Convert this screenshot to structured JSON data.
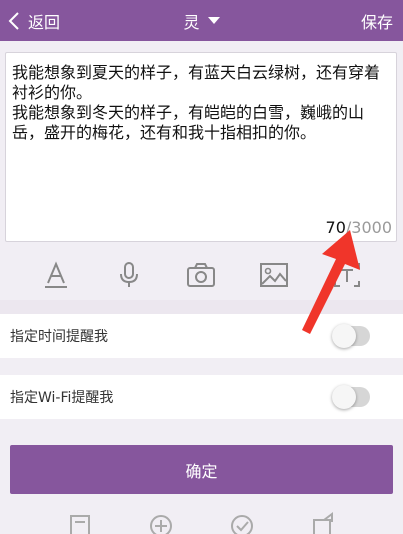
{
  "header": {
    "back_label": "返回",
    "title": "灵",
    "save_label": "保存"
  },
  "editor": {
    "text": "我能想象到夏天的样子，有蓝天白云绿树，还有穿着衬衫的你。\n我能想象到冬天的样子，有皑皑的白雪，巍峨的山岳，盛开的梅花，还有和我十指相扣的你。",
    "count_current": "70",
    "count_separator": "/",
    "count_max": "3000"
  },
  "toolbar": {
    "icons": [
      "text-style-icon",
      "microphone-icon",
      "camera-icon",
      "image-icon",
      "text-recognition-icon"
    ]
  },
  "settings": {
    "time_reminder_label": "指定时间提醒我",
    "wifi_reminder_label": "指定Wi-Fi提醒我",
    "time_reminder_on": false,
    "wifi_reminder_on": false
  },
  "confirm_label": "确定",
  "colors": {
    "accent": "#86569d",
    "annotation_arrow": "#f0352a"
  }
}
